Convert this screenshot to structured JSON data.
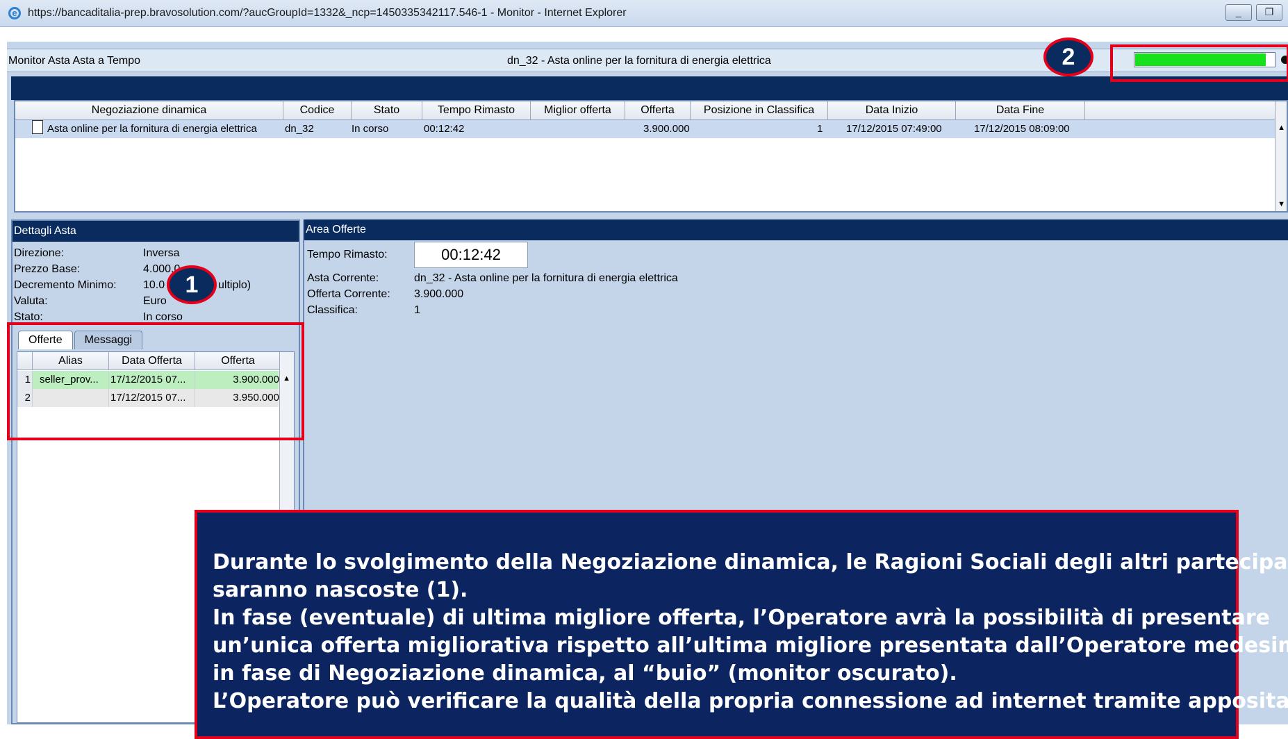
{
  "window": {
    "title": "https://bancaditalia-prep.bravosolution.com/?aucGroupId=1332&_ncp=1450335342117.546-1 - Monitor - Internet Explorer",
    "minimize": "_",
    "restore": "❐"
  },
  "monitor": {
    "left_title": "Monitor Asta Asta a Tempo",
    "center_title": "dn_32 - Asta online per la fornitura di energia elettrica",
    "connection_quality": 0.93
  },
  "top_table": {
    "headers": [
      "Negoziazione dinamica",
      "Codice",
      "Stato",
      "Tempo Rimasto",
      "Miglior offerta",
      "Offerta",
      "Posizione in Classifica",
      "Data Inizio",
      "Data Fine"
    ],
    "row": {
      "negoziazione": "Asta online per la fornitura di energia elettrica",
      "codice": "dn_32",
      "stato": "In corso",
      "tempo": "00:12:42",
      "miglior": "",
      "offerta": "3.900.000",
      "posizione": "1",
      "data_inizio": "17/12/2015 07:49:00",
      "data_fine": "17/12/2015 08:09:00"
    }
  },
  "dettagli": {
    "header": "Dettagli Asta",
    "items": [
      {
        "label": "Direzione:",
        "value": "Inversa"
      },
      {
        "label": "Prezzo Base:",
        "value": "4.000.0"
      },
      {
        "label": "Decremento Minimo:",
        "value": "10.0"
      },
      {
        "label": "Valuta:",
        "value": "Euro"
      },
      {
        "label": "Stato:",
        "value": "In corso"
      }
    ],
    "decremento_suffix": "ultiplo)"
  },
  "tabs": {
    "offerte": "Offerte",
    "messaggi": "Messaggi"
  },
  "offers_table": {
    "headers": [
      "Alias",
      "Data Offerta",
      "Offerta"
    ],
    "rows": [
      {
        "n": "1",
        "alias": "seller_prov...",
        "data": "17/12/2015 07...",
        "offerta": "3.900.000"
      },
      {
        "n": "2",
        "alias": "",
        "data": "17/12/2015 07...",
        "offerta": "3.950.000"
      }
    ]
  },
  "area_offerte": {
    "header": "Area Offerte",
    "tempo_label": "Tempo Rimasto:",
    "tempo_value": "00:12:42",
    "asta_label": "Asta Corrente:",
    "asta_value": "dn_32 - Asta online per la fornitura di energia elettrica",
    "offerta_label": "Offerta Corrente:",
    "offerta_value": "3.900.000",
    "classifica_label": "Classifica:",
    "classifica_value": "1"
  },
  "annotations": {
    "badge1": "1",
    "badge2": "2",
    "note_lines": [
      "Durante lo svolgimento della Negoziazione dinamica, le Ragioni Sociali degli altri partecipanti",
      "saranno nascoste (1).",
      "In fase (eventuale) di ultima migliore offerta, l’Operatore avrà la possibilità di presentare",
      "un’unica offerta migliorativa rispetto all’ultima migliore presentata dall’Operatore medesimo",
      "in fase di Negoziazione dinamica, al “buio” (monitor oscurato).",
      "L’Operatore può verificare la qualità della propria connessione ad internet tramite apposita"
    ]
  },
  "colors": {
    "navy": "#0a2b5d",
    "panel": "#c4d5ea",
    "annotation_red": "#e3001b",
    "progress_green": "#17e01d"
  }
}
